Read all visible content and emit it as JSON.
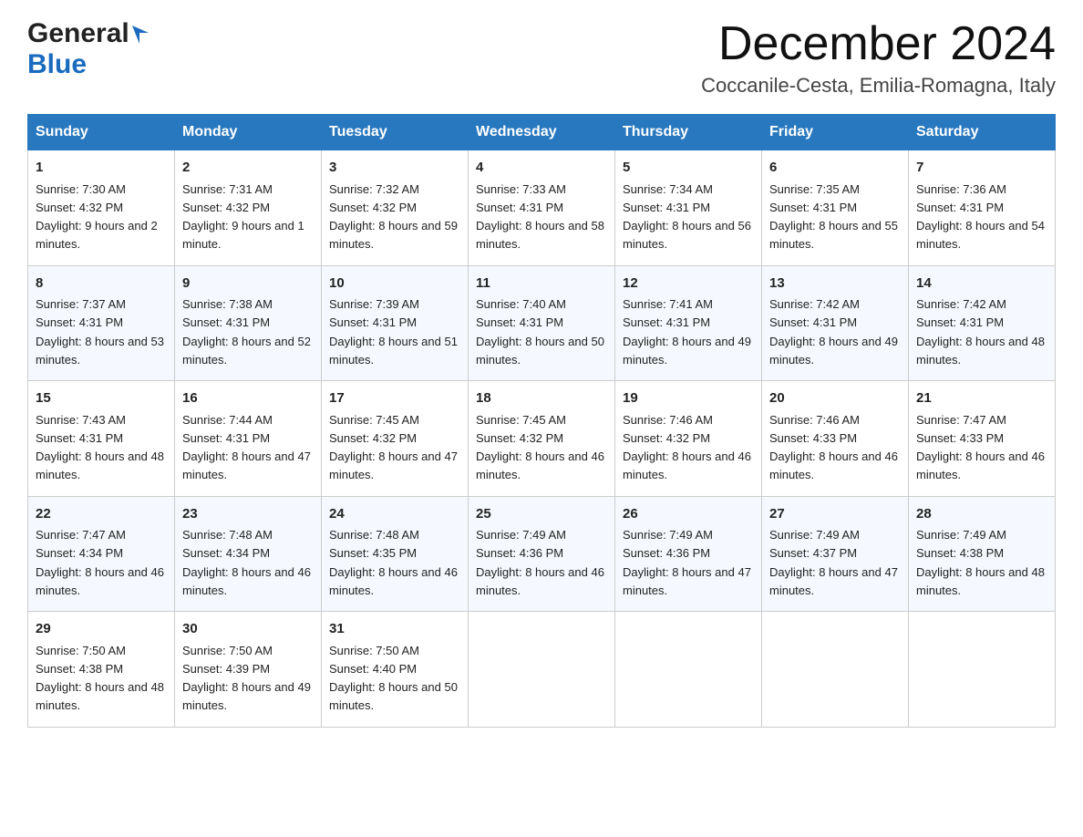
{
  "header": {
    "logo": {
      "line1": "General",
      "line2": "Blue"
    },
    "title": "December 2024",
    "location": "Coccanile-Cesta, Emilia-Romagna, Italy"
  },
  "days_of_week": [
    "Sunday",
    "Monday",
    "Tuesday",
    "Wednesday",
    "Thursday",
    "Friday",
    "Saturday"
  ],
  "weeks": [
    [
      {
        "num": "1",
        "sunrise": "7:30 AM",
        "sunset": "4:32 PM",
        "daylight": "9 hours and 2 minutes."
      },
      {
        "num": "2",
        "sunrise": "7:31 AM",
        "sunset": "4:32 PM",
        "daylight": "9 hours and 1 minute."
      },
      {
        "num": "3",
        "sunrise": "7:32 AM",
        "sunset": "4:32 PM",
        "daylight": "8 hours and 59 minutes."
      },
      {
        "num": "4",
        "sunrise": "7:33 AM",
        "sunset": "4:31 PM",
        "daylight": "8 hours and 58 minutes."
      },
      {
        "num": "5",
        "sunrise": "7:34 AM",
        "sunset": "4:31 PM",
        "daylight": "8 hours and 56 minutes."
      },
      {
        "num": "6",
        "sunrise": "7:35 AM",
        "sunset": "4:31 PM",
        "daylight": "8 hours and 55 minutes."
      },
      {
        "num": "7",
        "sunrise": "7:36 AM",
        "sunset": "4:31 PM",
        "daylight": "8 hours and 54 minutes."
      }
    ],
    [
      {
        "num": "8",
        "sunrise": "7:37 AM",
        "sunset": "4:31 PM",
        "daylight": "8 hours and 53 minutes."
      },
      {
        "num": "9",
        "sunrise": "7:38 AM",
        "sunset": "4:31 PM",
        "daylight": "8 hours and 52 minutes."
      },
      {
        "num": "10",
        "sunrise": "7:39 AM",
        "sunset": "4:31 PM",
        "daylight": "8 hours and 51 minutes."
      },
      {
        "num": "11",
        "sunrise": "7:40 AM",
        "sunset": "4:31 PM",
        "daylight": "8 hours and 50 minutes."
      },
      {
        "num": "12",
        "sunrise": "7:41 AM",
        "sunset": "4:31 PM",
        "daylight": "8 hours and 49 minutes."
      },
      {
        "num": "13",
        "sunrise": "7:42 AM",
        "sunset": "4:31 PM",
        "daylight": "8 hours and 49 minutes."
      },
      {
        "num": "14",
        "sunrise": "7:42 AM",
        "sunset": "4:31 PM",
        "daylight": "8 hours and 48 minutes."
      }
    ],
    [
      {
        "num": "15",
        "sunrise": "7:43 AM",
        "sunset": "4:31 PM",
        "daylight": "8 hours and 48 minutes."
      },
      {
        "num": "16",
        "sunrise": "7:44 AM",
        "sunset": "4:31 PM",
        "daylight": "8 hours and 47 minutes."
      },
      {
        "num": "17",
        "sunrise": "7:45 AM",
        "sunset": "4:32 PM",
        "daylight": "8 hours and 47 minutes."
      },
      {
        "num": "18",
        "sunrise": "7:45 AM",
        "sunset": "4:32 PM",
        "daylight": "8 hours and 46 minutes."
      },
      {
        "num": "19",
        "sunrise": "7:46 AM",
        "sunset": "4:32 PM",
        "daylight": "8 hours and 46 minutes."
      },
      {
        "num": "20",
        "sunrise": "7:46 AM",
        "sunset": "4:33 PM",
        "daylight": "8 hours and 46 minutes."
      },
      {
        "num": "21",
        "sunrise": "7:47 AM",
        "sunset": "4:33 PM",
        "daylight": "8 hours and 46 minutes."
      }
    ],
    [
      {
        "num": "22",
        "sunrise": "7:47 AM",
        "sunset": "4:34 PM",
        "daylight": "8 hours and 46 minutes."
      },
      {
        "num": "23",
        "sunrise": "7:48 AM",
        "sunset": "4:34 PM",
        "daylight": "8 hours and 46 minutes."
      },
      {
        "num": "24",
        "sunrise": "7:48 AM",
        "sunset": "4:35 PM",
        "daylight": "8 hours and 46 minutes."
      },
      {
        "num": "25",
        "sunrise": "7:49 AM",
        "sunset": "4:36 PM",
        "daylight": "8 hours and 46 minutes."
      },
      {
        "num": "26",
        "sunrise": "7:49 AM",
        "sunset": "4:36 PM",
        "daylight": "8 hours and 47 minutes."
      },
      {
        "num": "27",
        "sunrise": "7:49 AM",
        "sunset": "4:37 PM",
        "daylight": "8 hours and 47 minutes."
      },
      {
        "num": "28",
        "sunrise": "7:49 AM",
        "sunset": "4:38 PM",
        "daylight": "8 hours and 48 minutes."
      }
    ],
    [
      {
        "num": "29",
        "sunrise": "7:50 AM",
        "sunset": "4:38 PM",
        "daylight": "8 hours and 48 minutes."
      },
      {
        "num": "30",
        "sunrise": "7:50 AM",
        "sunset": "4:39 PM",
        "daylight": "8 hours and 49 minutes."
      },
      {
        "num": "31",
        "sunrise": "7:50 AM",
        "sunset": "4:40 PM",
        "daylight": "8 hours and 50 minutes."
      },
      null,
      null,
      null,
      null
    ]
  ]
}
